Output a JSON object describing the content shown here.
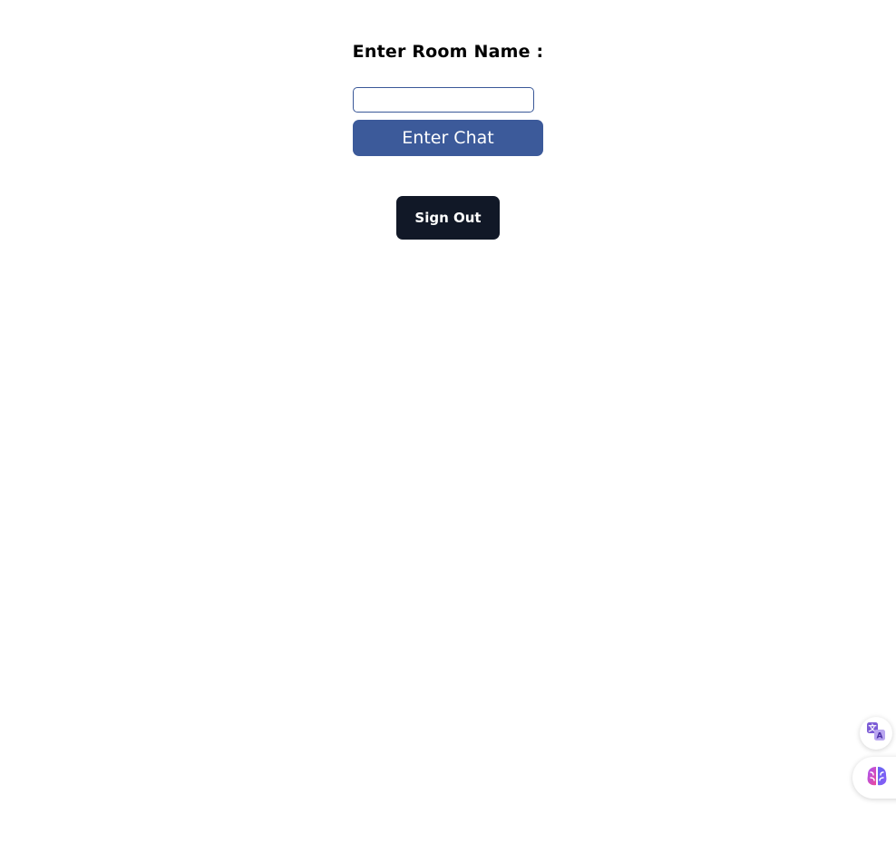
{
  "form": {
    "room_label": "Enter Room Name :",
    "room_input_value": "",
    "enter_chat_label": "Enter Chat"
  },
  "auth": {
    "sign_out_label": "Sign Out"
  },
  "floating_widgets": [
    {
      "icon": "translate-icon"
    },
    {
      "icon": "brain-icon"
    }
  ],
  "colors": {
    "enter_chat_bg": "#3c5a9a",
    "sign_out_bg": "#111827",
    "input_border": "#3a5898"
  }
}
